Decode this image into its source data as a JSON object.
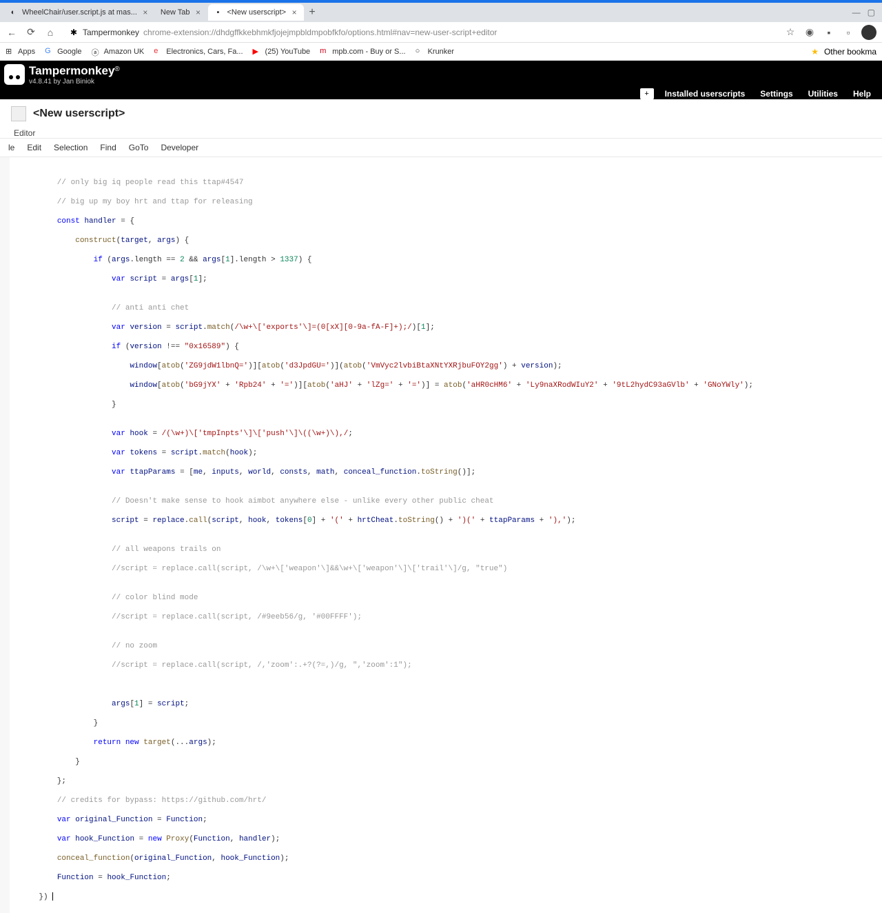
{
  "browser": {
    "tabs": [
      {
        "title": "WheelChair/user.script.js at mas..."
      },
      {
        "title": "New Tab"
      },
      {
        "title": "<New userscript>"
      }
    ],
    "url_host": "Tampermonkey",
    "url_path": "chrome-extension://dhdgffkkebhmkfjojejmpbldmpobfkfo/options.html#nav=new-user-script+editor",
    "bookmarks": [
      "Apps",
      "Google",
      "Amazon UK",
      "Electronics, Cars, Fa...",
      "(25) YouTube",
      "mpb.com - Buy or S...",
      "Krunker"
    ],
    "other_bookmarks": "Other bookma"
  },
  "app": {
    "title": "Tampermonkey",
    "reg": "®",
    "version": "v4.8.41 by Jan Biniok",
    "nav": [
      "Installed userscripts",
      "Settings",
      "Utilities",
      "Help"
    ],
    "script_title": "<New userscript>",
    "editor_tab": "Editor",
    "menu": [
      "le",
      "Edit",
      "Selection",
      "Find",
      "GoTo",
      "Developer"
    ]
  },
  "code": {
    "l1": "        // only big iq people read this ttap#4547",
    "l2": "        // big up my boy hrt and ttap for releasing",
    "l3": "        const handler = {",
    "l4": "            construct(target, args) {",
    "l5": "                if (args.length == 2 && args[1].length > 1337) {",
    "l6": "                    var script = args[1];",
    "l7": "",
    "l8": "                    // anti anti chet",
    "l9a": "                    var version = script.match(",
    "l9b": "/\\w+\\['exports'\\]=(0[xX][0-9a-fA-F]+);/",
    "l9c": ")[1];",
    "l10": "                    if (version !== \"0x16589\") {",
    "l11a": "                        window[atob(",
    "l11b": "'ZG9jdW1lbnQ='",
    "l11c": ")][atob(",
    "l11d": "'d3JpdGU='",
    "l11e": ")](atob(",
    "l11f": "'VmVyc2lvbiBtaXNtYXRjbuFOY2gg'",
    "l11g": ") + version);",
    "l12a": "                        window[atob(",
    "l12b": "'bG9jYX'",
    "l12c": " + ",
    "l12d": "'Rpb24'",
    "l12e": " + ",
    "l12f": "'='",
    "l12g": ")][atob(",
    "l12h": "'aHJ'",
    "l12i": " + ",
    "l12j": "'lZg='",
    "l12k": " + ",
    "l12l": "'='",
    "l12m": ")] = atob(",
    "l12n": "'aHR0cHM6'",
    "l12o": " + ",
    "l12p": "'Ly9naXRodWIuY2'",
    "l12q": " + ",
    "l12r": "'9tL2hydC93aGVlb'",
    "l12s": " + ",
    "l12t": "'GNoYWly'",
    "l12u": ");",
    "l13": "                    }",
    "l14": "",
    "l15a": "                    var hook = ",
    "l15b": "/(\\w+)\\['tmpInpts'\\]\\['push'\\]\\((\\w+)\\),/",
    "l15c": ";",
    "l16": "                    var tokens = script.match(hook);",
    "l17": "                    var ttapParams = [me, inputs, world, consts, math, conceal_function.toString()];",
    "l18": "",
    "l19": "                    // Doesn't make sense to hook aimbot anywhere else - unlike every other public cheat",
    "l20a": "                    script = replace.call(script, hook, tokens[",
    "l20b": "0",
    "l20c": "] + ",
    "l20d": "'('",
    "l20e": " + hrtCheat.toString() + ",
    "l20f": "')('",
    "l20g": " + ttapParams + ",
    "l20h": "'),'",
    "l20i": ");",
    "l21": "",
    "l22": "                    // all weapons trails on",
    "l23": "                    //script = replace.call(script, /\\w+\\['weapon'\\]&&\\w+\\['weapon'\\]\\['trail'\\]/g, \"true\")",
    "l24": "",
    "l25": "                    // color blind mode",
    "l26": "                    //script = replace.call(script, /#9eeb56/g, '#00FFFF');",
    "l27": "",
    "l28": "                    // no zoom",
    "l29": "                    //script = replace.call(script, /,'zoom':.+?(?=,)/g, \",'zoom':1\");",
    "l30": "",
    "l31": "",
    "l32": "                    args[1] = script;",
    "l33": "                }",
    "l34": "                return new target(...args);",
    "l35": "            }",
    "l36": "        };",
    "l37": "        // credits for bypass: https://github.com/hrt/",
    "l38": "        var original_Function = Function;",
    "l39": "        var hook_Function = new Proxy(Function, handler);",
    "l40": "        conceal_function(original_Function, hook_Function);",
    "l41": "        Function = hook_Function;",
    "l42": "    })"
  }
}
